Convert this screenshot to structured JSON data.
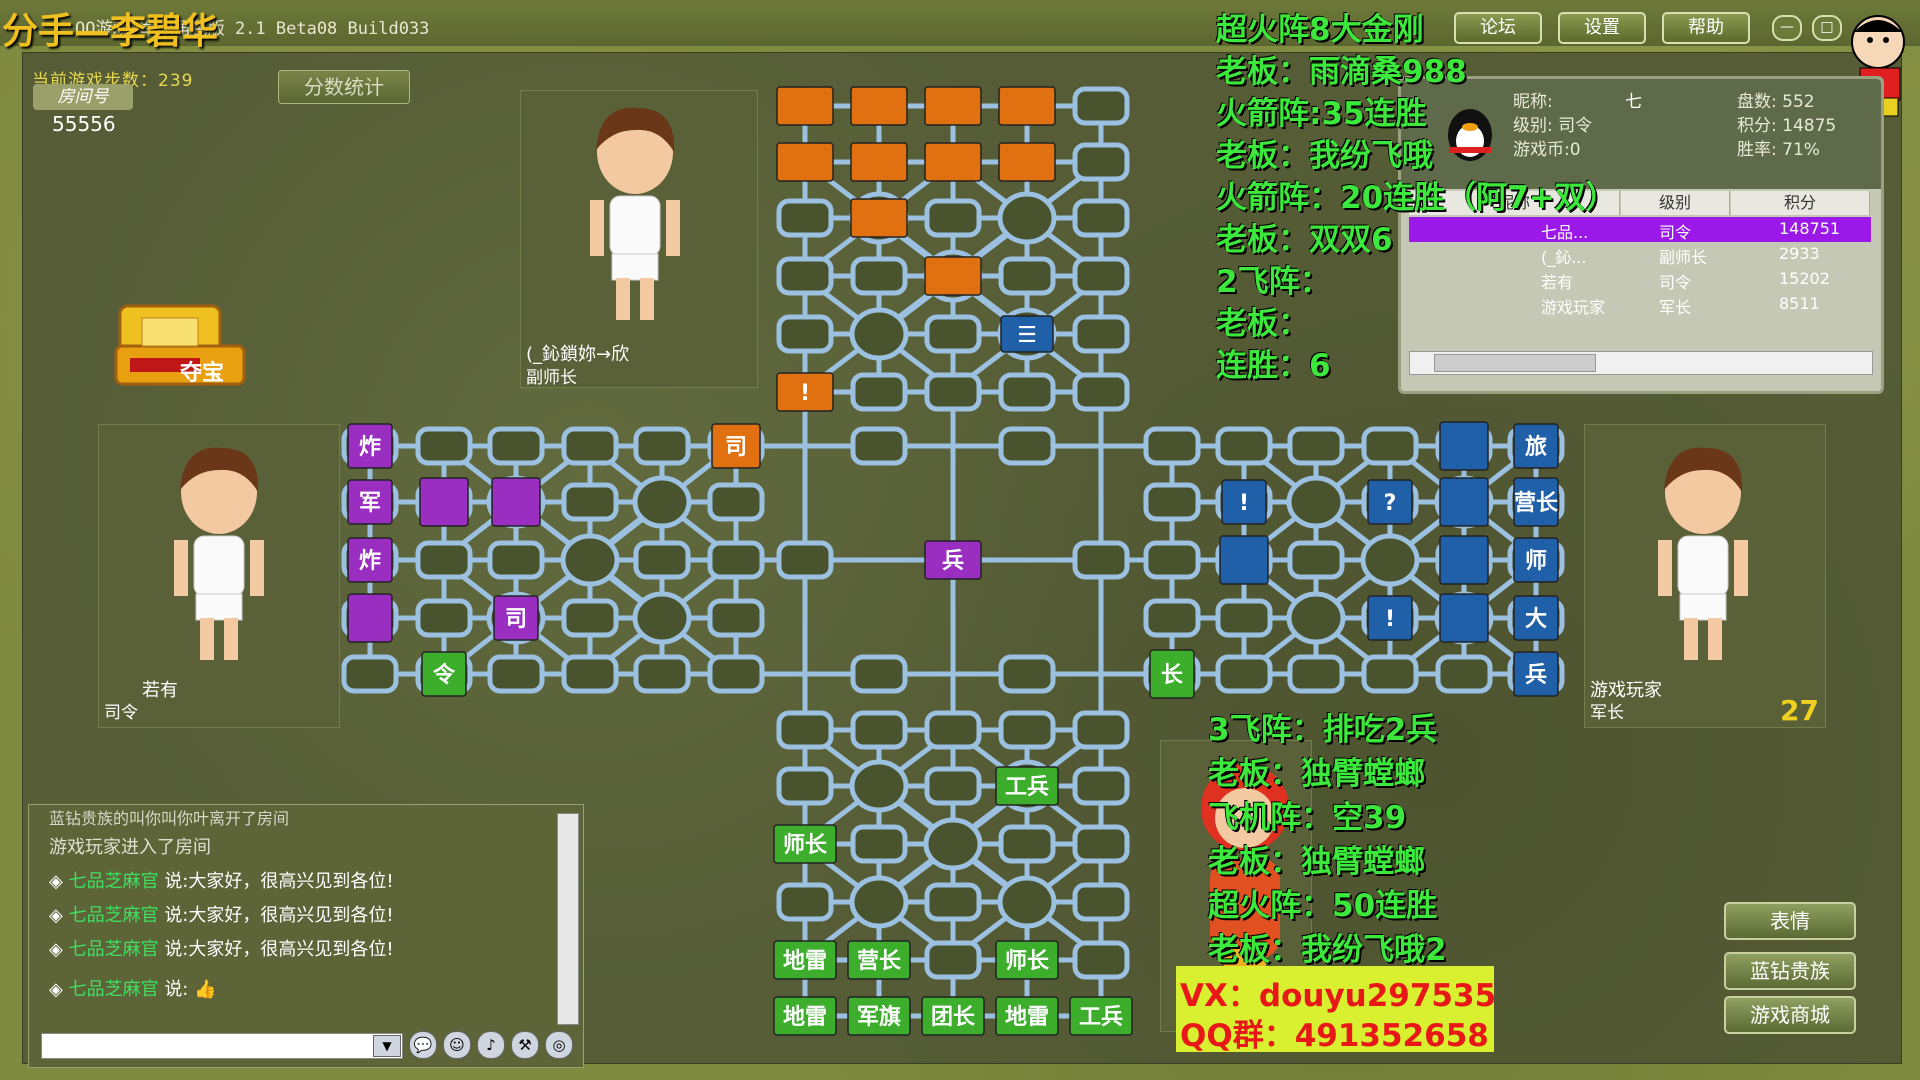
{
  "window": {
    "title": "QQ游戏 军旗角色版 2.1 Beta08 Build033",
    "overlay_name": "分手—李碧华",
    "buttons": {
      "forum": "论坛",
      "settings": "设置",
      "help": "帮助"
    }
  },
  "room": {
    "label": "房间号",
    "number": "55556",
    "steps": "当前游戏步数：239",
    "score_button": "分数统计"
  },
  "players": {
    "top": {
      "name": "(_鈊鎖妳→欣",
      "rank": "副师长"
    },
    "left": {
      "name": "若有",
      "rank": "司令"
    },
    "right": {
      "name": "游戏玩家",
      "rank": "军长",
      "timer": "27"
    }
  },
  "info": {
    "nick_label": "昵称:",
    "nick_value": "七",
    "level_label": "级别: 司令",
    "coins_label": "游戏币:0",
    "games_label": "盘数: 552",
    "points_label": "积分: 14875",
    "winrate_label": "胜率: 71%",
    "headers": [
      "昵称",
      "级别",
      "积分"
    ],
    "rows": [
      {
        "name": "七品...",
        "level": "司令",
        "score": "148751"
      },
      {
        "name": "(_鈊...",
        "level": "副师长",
        "score": "2933"
      },
      {
        "name": "若有",
        "level": "司令",
        "score": "15202"
      },
      {
        "name": "游戏玩家",
        "level": "军长",
        "score": "8511"
      }
    ]
  },
  "overlay_top": [
    "超火阵8大金刚",
    "老板：雨滴桑988",
    "火箭阵:35连胜",
    "老板：我纷飞哦",
    "火箭阵：20连胜（阿7+双）",
    "老板：双双6",
    "2飞阵：",
    "老板：",
    "连胜：6"
  ],
  "overlay_bottom": [
    "3飞阵：排吃2兵",
    "老板：独臂螳螂",
    "飞机阵：空39",
    "老板：独臂螳螂",
    "超火阵：50连胜",
    "老板：我纷飞哦2"
  ],
  "contact": {
    "vx": "VX：douyu297535",
    "qq": "QQ群：491352658"
  },
  "chat": {
    "system1": "蓝钻贵族的叫你叫你叶离开了房间",
    "system2": "游戏玩家进入了房间",
    "lines": [
      {
        "user": "七品芝麻官",
        "text": "说:大家好，很高兴见到各位!"
      },
      {
        "user": "七品芝麻官",
        "text": "说:大家好，很高兴见到各位!"
      },
      {
        "user": "七品芝麻官",
        "text": "说:大家好，很高兴见到各位!"
      },
      {
        "user": "七品芝麻官",
        "text": "说:"
      }
    ]
  },
  "side_buttons": {
    "emotes": "表情",
    "vip": "蓝钻贵族",
    "shop": "游戏商城"
  },
  "treasure_label": "夺宝",
  "pieces": {
    "left": [
      "炸",
      "军",
      "炸",
      "司",
      "司",
      "令"
    ],
    "right": [
      "旅",
      "营长",
      "师",
      "大",
      "兵",
      "!",
      "?",
      "!",
      "长"
    ],
    "center": [
      "兵",
      "!"
    ],
    "bottom": [
      "工兵",
      "师长",
      "地雷",
      "营长",
      "师长",
      "地雷",
      "军旗",
      "团长",
      "地雷",
      "工兵"
    ]
  },
  "colors": {
    "orange": "#e07010",
    "purple": "#9a2ec0",
    "blue": "#2060a8",
    "green": "#3cae2c",
    "track": "#9cc0e0"
  }
}
